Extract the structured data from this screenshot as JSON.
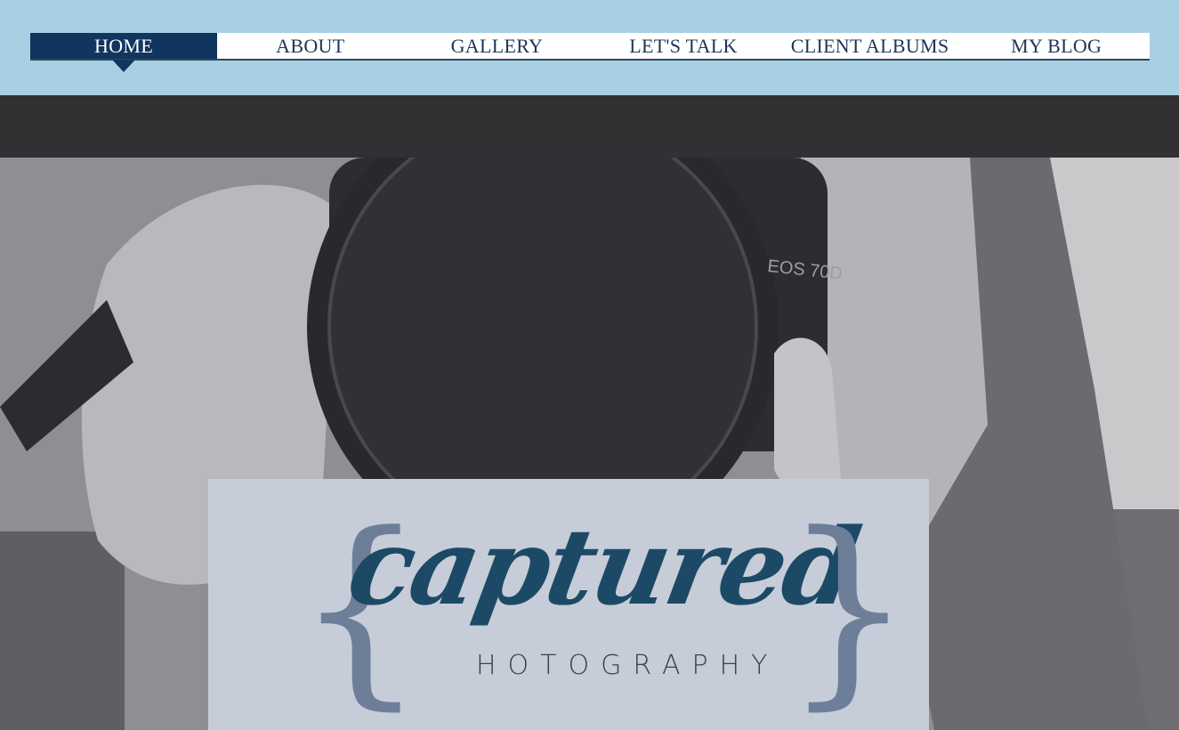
{
  "nav": {
    "items": [
      {
        "label": "HOME",
        "active": true
      },
      {
        "label": "ABOUT",
        "active": false
      },
      {
        "label": "GALLERY",
        "active": false
      },
      {
        "label": "LET'S TALK",
        "active": false
      },
      {
        "label": "CLIENT ALBUMS",
        "active": false
      },
      {
        "label": "MY BLOG",
        "active": false
      }
    ]
  },
  "hero": {
    "camera_model_text": "EOS 70D"
  },
  "logo": {
    "brace_open": "{",
    "script": "captured",
    "sub": "HOTOGRAPHY",
    "brace_close": "}"
  },
  "colors": {
    "sky_band": "#a8d0e4",
    "nav_active": "#10355f",
    "dark_band": "#323033",
    "logo_panel": "#c6cdd8",
    "logo_script": "#1c4a66",
    "brace": "#6d7f98"
  }
}
